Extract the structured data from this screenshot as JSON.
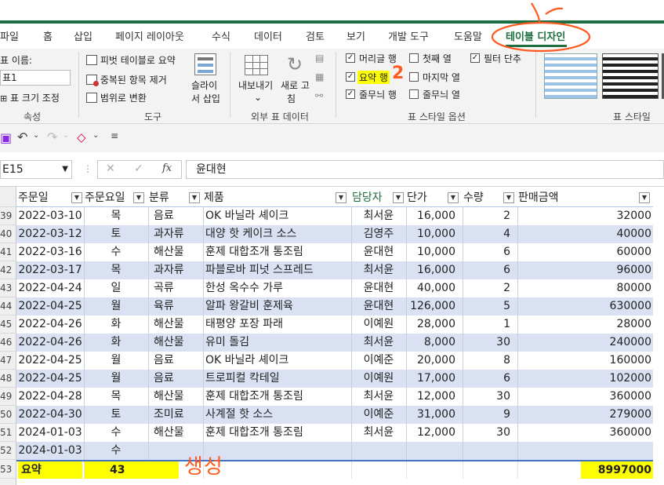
{
  "ribbon_tabs": [
    "파일",
    "홈",
    "삽입",
    "페이지 레이아웃",
    "수식",
    "데이터",
    "검토",
    "보기",
    "개발 도구",
    "도움말",
    "테이블 디자인"
  ],
  "properties_group": {
    "name_label": "표 이름:",
    "name_value": "표1",
    "resize": "표 크기 조정",
    "label": "속성"
  },
  "tools_group": {
    "pivot": "피벗 테이블로 요약",
    "remove_dup": "중복된 항목 제거",
    "to_range": "범위로 변환",
    "slicer_line1": "슬라이",
    "slicer_line2": "서 삽입",
    "label": "도구"
  },
  "external_group": {
    "export_line1": "내보내기",
    "refresh_line1": "새로 고",
    "refresh_line2": "침",
    "label": "외부 표 데이터"
  },
  "style_options": {
    "header_row": "머리글 행",
    "first_column": "첫째 열",
    "filter_button": "필터 단추",
    "total_row": "요약 행",
    "last_column": "마지막 열",
    "banded_rows": "줄무늬 행",
    "banded_columns": "줄무늬 열",
    "label": "표 스타일 옵션",
    "checked_mark": "✓"
  },
  "table_styles_label": "표 스타일",
  "formula_bar": {
    "namebox": "E15",
    "cancel": "✕",
    "enter": "✓",
    "fx": "fx",
    "value": "윤대현"
  },
  "columns": [
    "주문일",
    "주문요일",
    "분류",
    "제품",
    "담당자",
    "단가",
    "수량",
    "판매금액"
  ],
  "rows": [
    {
      "n": "39",
      "date": "2022-03-10",
      "day": "목",
      "cat": "음료",
      "product": "OK 바닐라 셰이크",
      "rep": "최서윤",
      "price": "16,000",
      "qty": "2",
      "amount": "32000"
    },
    {
      "n": "40",
      "date": "2022-03-12",
      "day": "토",
      "cat": "과자류",
      "product": "대양 핫 케이크 소스",
      "rep": "김영주",
      "price": "10,000",
      "qty": "4",
      "amount": "40000"
    },
    {
      "n": "41",
      "date": "2022-03-16",
      "day": "수",
      "cat": "해산물",
      "product": "훈제 대합조개 통조림",
      "rep": "윤대현",
      "price": "10,000",
      "qty": "6",
      "amount": "60000"
    },
    {
      "n": "42",
      "date": "2022-03-17",
      "day": "목",
      "cat": "과자류",
      "product": "파블로바 피넛 스프레드",
      "rep": "최서윤",
      "price": "16,000",
      "qty": "6",
      "amount": "96000"
    },
    {
      "n": "43",
      "date": "2022-04-24",
      "day": "일",
      "cat": "곡류",
      "product": "한성 옥수수 가루",
      "rep": "윤대현",
      "price": "40,000",
      "qty": "2",
      "amount": "80000"
    },
    {
      "n": "44",
      "date": "2022-04-25",
      "day": "월",
      "cat": "육류",
      "product": "알파 왕갈비 훈제육",
      "rep": "윤대현",
      "price": "126,000",
      "qty": "5",
      "amount": "630000"
    },
    {
      "n": "45",
      "date": "2022-04-26",
      "day": "화",
      "cat": "해산물",
      "product": "태평양 포장 파래",
      "rep": "이예원",
      "price": "28,000",
      "qty": "1",
      "amount": "28000"
    },
    {
      "n": "46",
      "date": "2022-04-26",
      "day": "화",
      "cat": "해산물",
      "product": "유미 돌김",
      "rep": "최서윤",
      "price": "8,000",
      "qty": "30",
      "amount": "240000"
    },
    {
      "n": "47",
      "date": "2022-04-25",
      "day": "월",
      "cat": "음료",
      "product": "OK 바닐라 셰이크",
      "rep": "이예준",
      "price": "20,000",
      "qty": "8",
      "amount": "160000"
    },
    {
      "n": "48",
      "date": "2022-04-25",
      "day": "월",
      "cat": "음료",
      "product": "트로피컬 칵테일",
      "rep": "이예원",
      "price": "17,000",
      "qty": "6",
      "amount": "102000"
    },
    {
      "n": "49",
      "date": "2022-04-28",
      "day": "목",
      "cat": "해산물",
      "product": "훈제 대합조개 통조림",
      "rep": "최서윤",
      "price": "12,000",
      "qty": "30",
      "amount": "360000"
    },
    {
      "n": "50",
      "date": "2022-04-30",
      "day": "토",
      "cat": "조미료",
      "product": "사계절 핫 소스",
      "rep": "이예준",
      "price": "31,000",
      "qty": "9",
      "amount": "279000"
    },
    {
      "n": "51",
      "date": "2024-01-03",
      "day": "수",
      "cat": "해산물",
      "product": "훈제 대합조개 통조림",
      "rep": "최서윤",
      "price": "12,000",
      "qty": "30",
      "amount": "360000"
    },
    {
      "n": "52",
      "date": "2024-01-03",
      "day": "수",
      "cat": "",
      "product": "",
      "rep": "",
      "price": "",
      "qty": "",
      "amount": ""
    }
  ],
  "total_row": {
    "n": "53",
    "label": "요약",
    "count": "43",
    "amount": "8997000"
  },
  "annotations": {
    "number": "2",
    "handwriting": "생성"
  },
  "colors": {
    "excel_green": "#1e6e42",
    "band": "#dae1f2",
    "highlight": "#ffff00",
    "annotation": "#ff5a1f"
  }
}
